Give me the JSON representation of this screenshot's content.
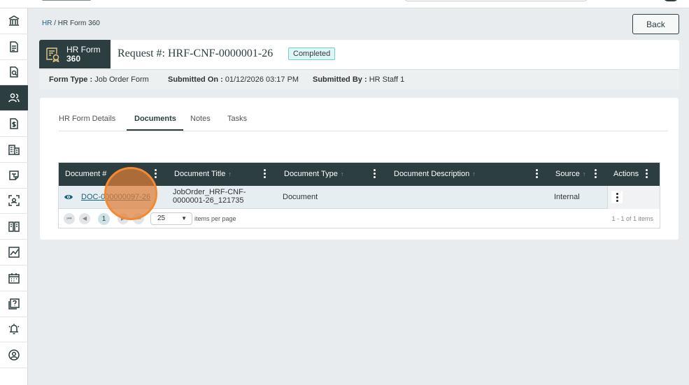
{
  "breadcrumb": {
    "root": "HR",
    "separator": " / ",
    "current": "HR Form 360"
  },
  "back_label": "Back",
  "header": {
    "badge_line1": "HR Form",
    "badge_line2": "360",
    "request_prefix": "Request #: ",
    "request_id": "HRF-CNF-0000001-26",
    "status": "Completed"
  },
  "meta": {
    "form_type_label": "Form Type :",
    "form_type_value": "Job Order Form",
    "submitted_on_label": "Submitted On :",
    "submitted_on_value": "01/12/2026 03:17 PM",
    "submitted_by_label": "Submitted By :",
    "submitted_by_value": "HR Staff 1"
  },
  "tabs": [
    "HR Form Details",
    "Documents",
    "Notes",
    "Tasks"
  ],
  "active_tab": "Documents",
  "grid": {
    "columns": [
      "Document #",
      "Document Title",
      "Document Type",
      "Document Description",
      "Source",
      "Actions"
    ],
    "rows": [
      {
        "doc_number": "DOC-000000097-26",
        "title_line1": "JobOrder_HRF-CNF-",
        "title_line2": "0000001-26_121735",
        "type": "Document",
        "description": "",
        "source": "Internal"
      }
    ],
    "pager": {
      "current_page": "1",
      "page_size": "25",
      "items_per_page_label": "items per page",
      "info": "1 - 1 of 1 items"
    }
  },
  "colors": {
    "primary": "#2c3e40",
    "status_bg": "#dff6f5",
    "click_highlight": "#f28a30"
  }
}
